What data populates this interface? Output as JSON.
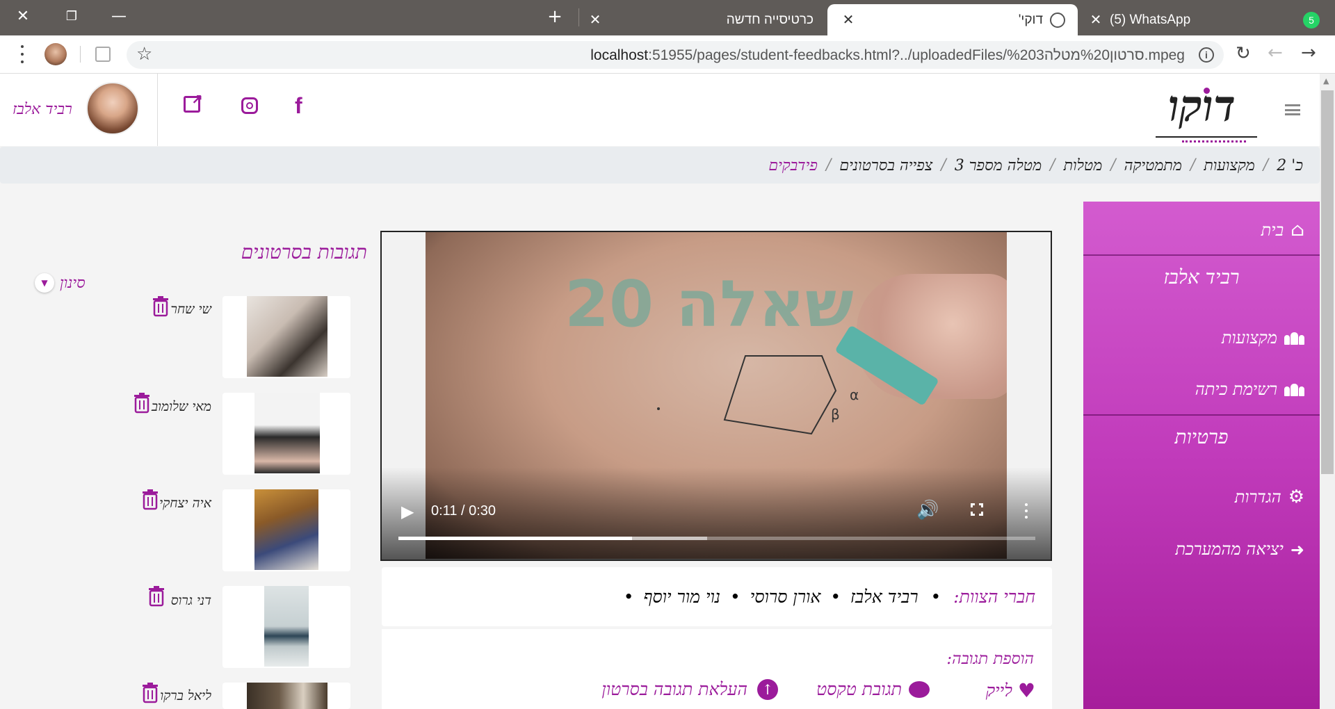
{
  "browser": {
    "tabs": [
      {
        "label": "(5) WhatsApp",
        "badge": "5"
      },
      {
        "label": "'דוקי"
      },
      {
        "label": "כרטיסייה חדשה"
      }
    ],
    "url": {
      "host": "localhost",
      "rest": ":51955/pages/student-feedbacks.html?../uploadedFiles/%203סרטון%20מטלה.mpeg"
    }
  },
  "header": {
    "logo_text": "דוקו",
    "user_name": "רביד אלבז"
  },
  "breadcrumb": [
    {
      "label": "כ' 2"
    },
    {
      "label": "מקצועות"
    },
    {
      "label": "מתמטיקה"
    },
    {
      "label": "מטלות"
    },
    {
      "label": "מטלה מספר 3"
    },
    {
      "label": "צפייה בסרטונים"
    },
    {
      "label": "פידבקים"
    }
  ],
  "sidebar": {
    "home": "בית",
    "user_name": "רביד אלבז",
    "subjects": "מקצועות",
    "class_list": "רשימת כיתה",
    "personal": "פרטיות",
    "settings": "הגדרות",
    "logout": "יציאה מהמערכת"
  },
  "video": {
    "time": "0:11 / 0:30",
    "progress_fraction": 0.367,
    "buffered_fraction": 0.485,
    "board_text": "שאלה 20",
    "label_a": "α",
    "label_b": "β"
  },
  "members": {
    "label": "חברי הצוות:",
    "names": [
      "רביד אלבז",
      "אורן סרוסי",
      "נוי מור יוסף"
    ]
  },
  "add_feedback": {
    "label": "הוספת תגובה:",
    "like": "לייק",
    "text_reply": "תגובת טקסט",
    "upload_reply": "העלאת תגובה בסרטון"
  },
  "feedbacks": {
    "title": "תגובות בסרטונים",
    "filter": "סינון",
    "items": [
      {
        "name": "שי שחר"
      },
      {
        "name": "מאי שלומוב"
      },
      {
        "name": "איה יצחקי"
      },
      {
        "name": "דני גרוס"
      },
      {
        "name": "ליאל ברקו"
      }
    ]
  },
  "colors": {
    "accent": "#9b1b9b",
    "sidebar": "#c13bbb"
  }
}
